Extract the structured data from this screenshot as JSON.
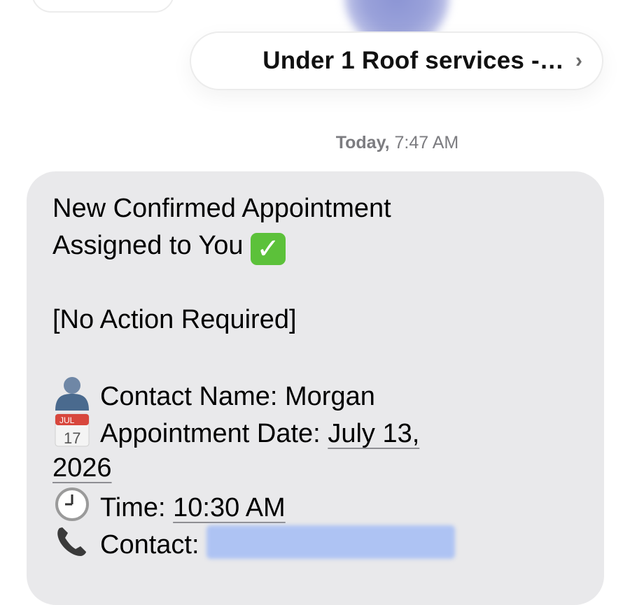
{
  "thread": {
    "contact_name": "Under 1 Roof services -…",
    "chevron": "›",
    "timestamp_day": "Today,",
    "timestamp_time": "7:47 AM"
  },
  "message": {
    "title_line1": "New Confirmed Appointment",
    "title_line2": "Assigned to You",
    "check_mark": "✓",
    "note": "[No Action Required]",
    "contact_label": "Contact Name: Morgan",
    "date_label": "Appointment Date: ",
    "date_value": "July 13,",
    "date_year": "2026",
    "time_label": "Time: ",
    "time_value": "10:30 AM",
    "phone_label": "Contact: ",
    "calendar_month": "JUL",
    "calendar_day": "17"
  },
  "colors": {
    "bubble": "#e9e9eb",
    "check": "#5cc13a",
    "redaction": "#aec3f3"
  },
  "icons": [
    "person-icon",
    "calendar-icon",
    "clock-icon",
    "phone-icon",
    "check-mark-icon",
    "chevron-right-icon"
  ]
}
